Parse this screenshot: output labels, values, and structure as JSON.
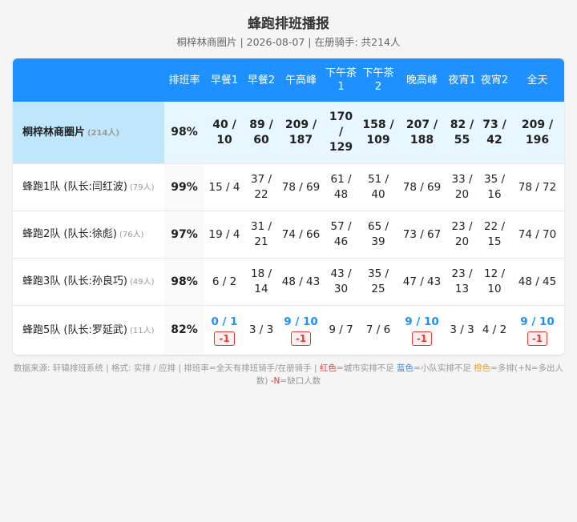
{
  "header": {
    "title": "蜂跑排班播报",
    "subtitle": "桐梓林商圈片 | 2026-08-07 | 在册骑手: 共214人"
  },
  "table": {
    "columns": [
      "排班率",
      "早餐1",
      "早餐2",
      "午高峰",
      "下午茶1",
      "下午茶2",
      "晚高峰",
      "夜宵1",
      "夜宵2",
      "全天"
    ],
    "summary": {
      "name": "桐梓林商圈片",
      "count": "(214人)",
      "rate": "98%",
      "cells": [
        {
          "v": "40 / 10"
        },
        {
          "v": "89 / 60"
        },
        {
          "v": "209 / 187"
        },
        {
          "v": "170 / 129"
        },
        {
          "v": "158 / 109"
        },
        {
          "v": "207 / 188"
        },
        {
          "v": "82 / 55"
        },
        {
          "v": "73 / 42"
        },
        {
          "v": "209 / 196"
        }
      ]
    },
    "rows": [
      {
        "name": "蜂跑1队 (队长:闫红波)",
        "count": "(79人)",
        "rate": "99%",
        "cells": [
          {
            "v": "15 / 4"
          },
          {
            "v": "37 / 22"
          },
          {
            "v": "78 / 69"
          },
          {
            "v": "61 / 48"
          },
          {
            "v": "51 / 40"
          },
          {
            "v": "78 / 69"
          },
          {
            "v": "33 / 20"
          },
          {
            "v": "35 / 16"
          },
          {
            "v": "78 / 72"
          }
        ]
      },
      {
        "name": "蜂跑2队 (队长:徐彪)",
        "count": "(76人)",
        "rate": "97%",
        "cells": [
          {
            "v": "19 / 4"
          },
          {
            "v": "31 / 21"
          },
          {
            "v": "74 / 66"
          },
          {
            "v": "57 / 46"
          },
          {
            "v": "65 / 39"
          },
          {
            "v": "73 / 67"
          },
          {
            "v": "23 / 20"
          },
          {
            "v": "22 / 15"
          },
          {
            "v": "74 / 70"
          }
        ]
      },
      {
        "name": "蜂跑3队 (队长:孙良巧)",
        "count": "(49人)",
        "rate": "98%",
        "cells": [
          {
            "v": "6 / 2"
          },
          {
            "v": "18 / 14"
          },
          {
            "v": "48 / 43"
          },
          {
            "v": "43 / 30"
          },
          {
            "v": "35 / 25"
          },
          {
            "v": "47 / 43"
          },
          {
            "v": "23 / 13"
          },
          {
            "v": "12 / 10"
          },
          {
            "v": "48 / 45"
          }
        ]
      },
      {
        "name": "蜂跑5队 (队长:罗延武)",
        "count": "(11人)",
        "rate": "82%",
        "cells": [
          {
            "v": "0 / 1",
            "status": "blue",
            "badge": "-1"
          },
          {
            "v": "3 / 3"
          },
          {
            "v": "9 / 10",
            "status": "blue",
            "badge": "-1"
          },
          {
            "v": "9 / 7"
          },
          {
            "v": "7 / 6"
          },
          {
            "v": "9 / 10",
            "status": "blue",
            "badge": "-1"
          },
          {
            "v": "3 / 3"
          },
          {
            "v": "4 / 2"
          },
          {
            "v": "9 / 10",
            "status": "blue",
            "badge": "-1"
          }
        ]
      }
    ]
  },
  "legend": {
    "part1": "数据来源: 轩辕排班系统 | 格式: 实排 / 应排 | 排班率=全天有排班骑手/在册骑手 | ",
    "red_label": "红色",
    "red_text": "=城市实排不足 ",
    "blue_label": "蓝色",
    "blue_text": "=小队实排不足 ",
    "orange_label": "橙色",
    "orange_text": "=多排(+N=多出人数) ",
    "neg_label": "-N",
    "neg_text": "=缺口人数"
  },
  "colors": {
    "header_bg": "#1e90ff",
    "summary_bg": "#e8f6ff",
    "red": "#e53935",
    "blue": "#1e90ff",
    "orange": "#f0a020"
  }
}
